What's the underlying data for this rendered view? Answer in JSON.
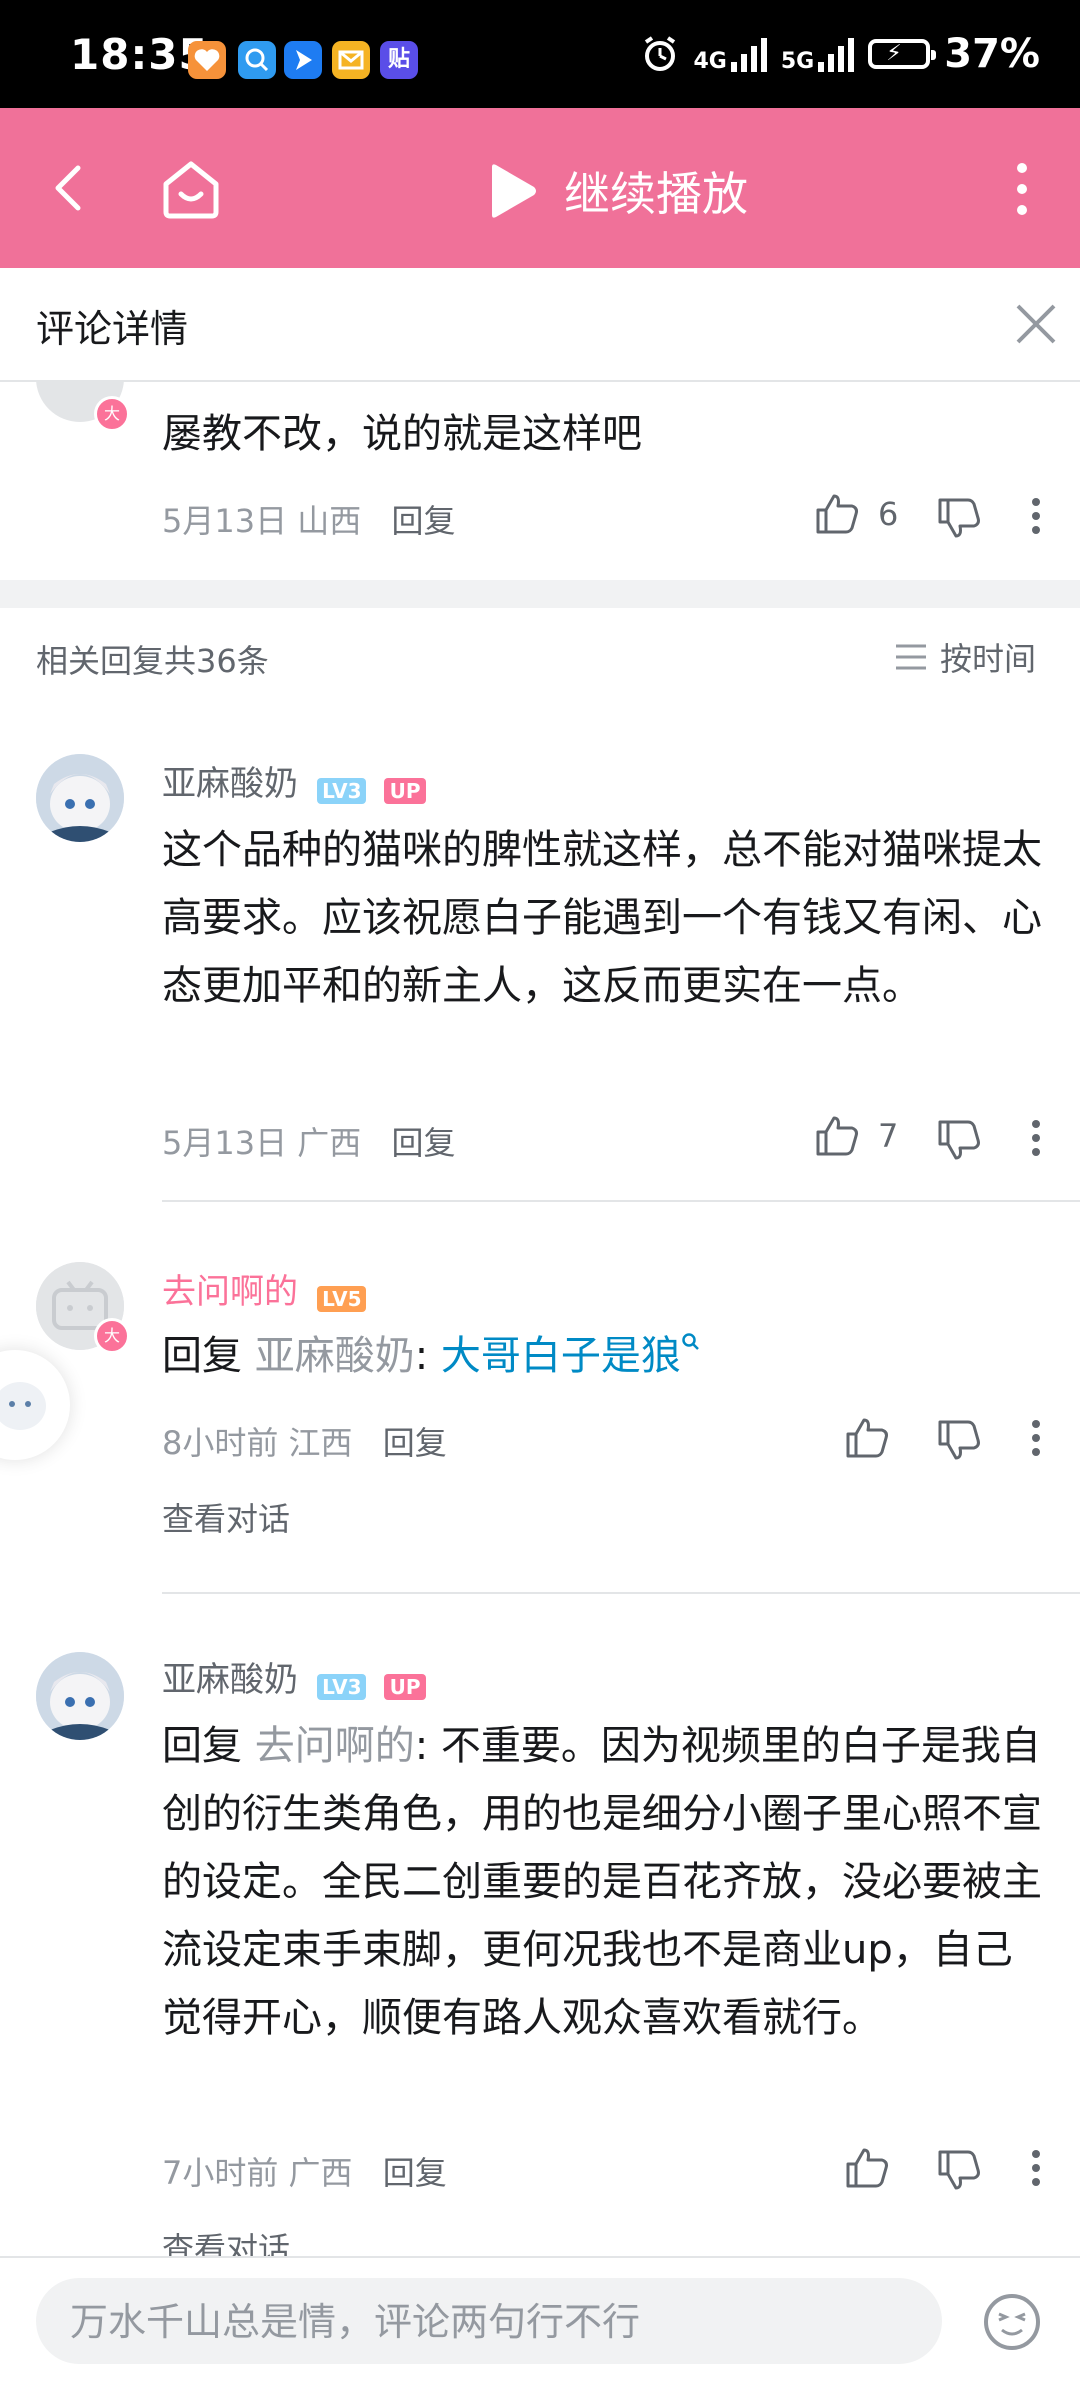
{
  "status_bar": {
    "time": "18:35",
    "network_4g": "4G",
    "network_5g": "5G",
    "battery": "37%",
    "app_icons": [
      "heart-app-icon",
      "search-app-icon",
      "location-app-icon",
      "mail-app-icon",
      "tieba-app-icon"
    ],
    "tieba_label": "贴"
  },
  "header": {
    "continue_play_label": "继续播放"
  },
  "detail": {
    "title": "评论详情"
  },
  "root_comment": {
    "text": "屡教不改，说的就是这样吧",
    "date": "5月13日",
    "location": "山西",
    "reply_label": "回复",
    "likes": "6",
    "avatar_badge": "大"
  },
  "replies_header": {
    "count_label": "相关回复共36条",
    "sort_label": "按时间"
  },
  "replies": [
    {
      "username": "亚麻酸奶",
      "level": "LV3",
      "up_badge": "UP",
      "text": "这个品种的猫咪的脾性就这样，总不能对猫咪提太高要求。应该祝愿白子能遇到一个有钱又有闲、心态更加平和的新主人，这反而更实在一点。",
      "date": "5月13日",
      "location": "广西",
      "reply_label": "回复",
      "likes": "7"
    },
    {
      "username": "去问啊的",
      "level": "LV5",
      "reply_prefix": "回复",
      "reply_target": "亚麻酸奶",
      "colon": ":",
      "text": "大哥白子是狼",
      "date": "8小时前",
      "location": "江西",
      "reply_label": "回复",
      "view_conversation": "查看对话",
      "avatar_badge": "大"
    },
    {
      "username": "亚麻酸奶",
      "level": "LV3",
      "up_badge": "UP",
      "reply_prefix": "回复",
      "reply_target": "去问啊的",
      "colon": ":",
      "text": "不重要。因为视频里的白子是我自创的衍生类角色，用的也是细分小圈子里心照不宣的设定。全民二创重要的是百花齐放，没必要被主流设定束手束脚，更何况我也不是商业up，自己觉得开心，顺便有路人观众喜欢看就行。",
      "date": "7小时前",
      "location": "广西",
      "reply_label": "回复",
      "view_conversation": "查看对话"
    }
  ],
  "composer": {
    "placeholder": "万水千山总是情，评论两句行不行"
  },
  "colors": {
    "brand_pink": "#f07199",
    "link_blue": "#008ac5",
    "lv3": "#8bd3f9",
    "lv5": "#ff9f52"
  }
}
